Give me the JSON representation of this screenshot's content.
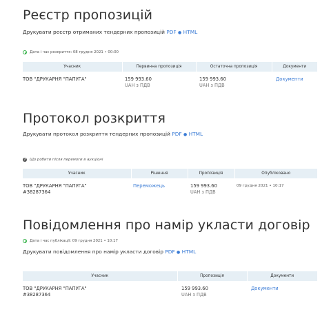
{
  "registry": {
    "title": "Реєстр пропозицій",
    "print_text": "Друкувати реєстр отриманих тендерних пропозицій",
    "pdf": "PDF",
    "html": "HTML",
    "meta": "Дата і час розкриття: 08 грудня 2021  •  00:00",
    "headers": [
      "Учасник",
      "Первинна пропозиція",
      "Остаточна пропозиція",
      "Документи"
    ],
    "rows": [
      {
        "participant": "ТОВ \"ДРУКАРНЯ \"ПАПУГА\"",
        "initial": "159 993.60",
        "initial_sub": "UAH з ПДВ",
        "final": "159 993.60",
        "final_sub": "UAH з ПДВ",
        "docs": "Документи"
      }
    ]
  },
  "protocol": {
    "title": "Протокол розкриття",
    "print_text": "Друкувати протокол розкриття тендерних пропозицій",
    "pdf": "PDF",
    "html": "HTML",
    "meta": "Що робити після перемоги в аукціоні",
    "headers": [
      "Учасник",
      "Рішення",
      "Пропозиція",
      "Опубліковано"
    ],
    "rows": [
      {
        "participant": "ТОВ \"ДРУКАРНЯ \"ПАПУГА\"",
        "code": "#38287364",
        "decision": "Переможець",
        "offer": "159 993.60",
        "offer_sub": "UAH з ПДВ",
        "published": "09 грудня 2021  •  10:17"
      }
    ]
  },
  "notice": {
    "title": "Повідомлення про намір укласти договір",
    "print_text": "Друкувати повідомлення про намір укласти договір",
    "pdf": "PDF",
    "html": "HTML",
    "meta": "Дата і час публікації: 09 грудня 2021  •  10:17",
    "headers": [
      "Учасник",
      "Пропозиція",
      "Документи"
    ],
    "rows": [
      {
        "participant": "ТОВ \"ДРУКАРНЯ \"ПАПУГА\"",
        "code": "#38287364",
        "offer": "159 993.60",
        "offer_sub": "UAH з ПДВ",
        "docs": "Документи"
      }
    ]
  },
  "colors": {
    "link": "#3a7bd5",
    "header_bg": "#e6eff5",
    "clock": "#37b34a"
  },
  "icons": [
    "clock-icon",
    "question-icon"
  ]
}
